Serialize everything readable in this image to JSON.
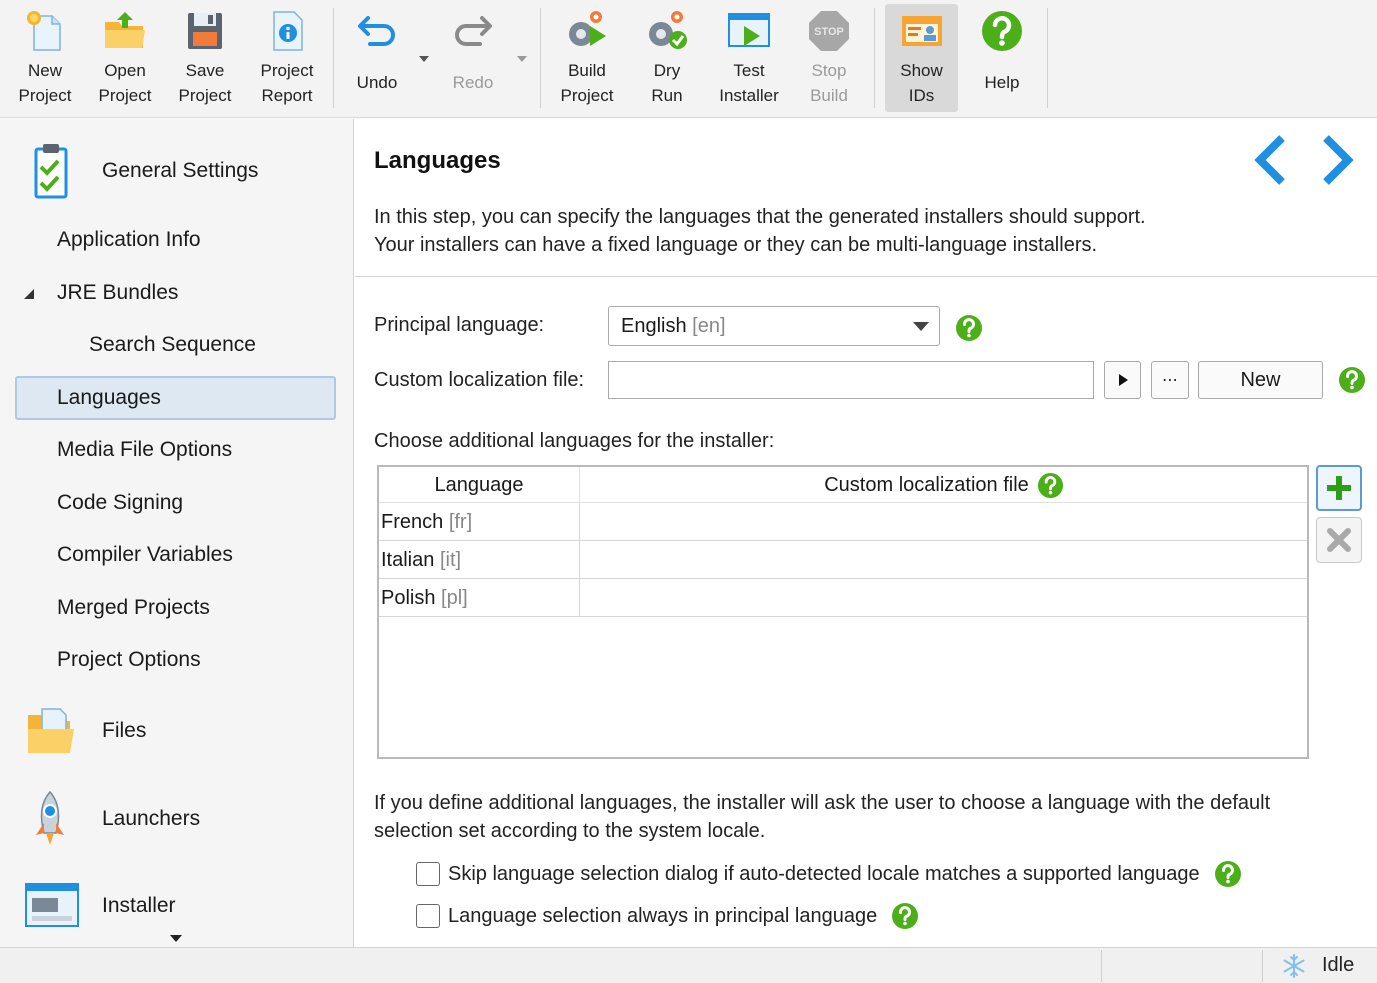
{
  "toolbar": {
    "new_project": "New\nProject",
    "open_project": "Open\nProject",
    "save_project": "Save\nProject",
    "project_report": "Project\nReport",
    "undo": "Undo",
    "redo": "Redo",
    "build_project": "Build\nProject",
    "dry_run": "Dry\nRun",
    "test_installer": "Test\nInstaller",
    "stop_build": "Stop\nBuild",
    "show_ids": "Show\nIDs",
    "help": "Help",
    "stop_sign_text": "STOP"
  },
  "sidebar": {
    "general_settings": "General Settings",
    "application_info": "Application Info",
    "jre_bundles": "JRE Bundles",
    "search_sequence": "Search Sequence",
    "languages": "Languages",
    "media_file_options": "Media File Options",
    "code_signing": "Code Signing",
    "compiler_variables": "Compiler Variables",
    "merged_projects": "Merged Projects",
    "project_options": "Project Options",
    "files": "Files",
    "launchers": "Launchers",
    "installer": "Installer"
  },
  "main": {
    "title": "Languages",
    "description_line1": "In this step, you can specify the languages that the generated installers should support.",
    "description_line2": "Your installers can have a fixed language or they can be multi-language installers.",
    "principal_language_label": "Principal language:",
    "principal_language_value": "English",
    "principal_language_code": "[en]",
    "custom_localization_label": "Custom localization file:",
    "custom_localization_value": "",
    "browse_button": "⋯",
    "new_button": "New",
    "additional_label": "Choose additional languages for the installer:",
    "table": {
      "col_language": "Language",
      "col_custom_file": "Custom localization file",
      "rows": [
        {
          "name": "French",
          "code": "[fr]",
          "file": ""
        },
        {
          "name": "Italian",
          "code": "[it]",
          "file": ""
        },
        {
          "name": "Polish",
          "code": "[pl]",
          "file": ""
        }
      ]
    },
    "note_line1": "If you define additional languages, the installer will ask the user to choose a language with the default",
    "note_line2": "selection set according to the system locale.",
    "checkbox_skip": "Skip language selection dialog if auto-detected locale matches a supported language",
    "checkbox_principal": "Language selection always in principal language"
  },
  "status": {
    "text": "Idle"
  },
  "colors": {
    "accent_blue": "#1e8fe1",
    "help_green": "#4caf1a",
    "selection_bg": "#dde8f3"
  }
}
